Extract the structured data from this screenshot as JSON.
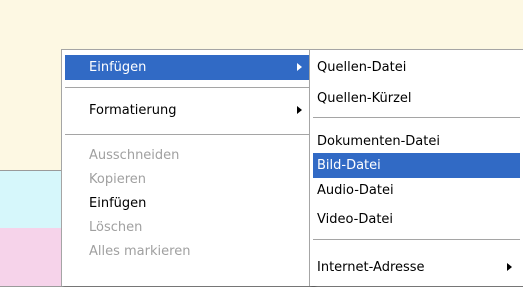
{
  "context_menu": {
    "items": [
      {
        "label": "Einfügen"
      },
      {
        "label": "Formatierung"
      },
      {
        "label": "Ausschneiden"
      },
      {
        "label": "Kopieren"
      },
      {
        "label": "Einfügen"
      },
      {
        "label": "Löschen"
      },
      {
        "label": "Alles markieren"
      }
    ]
  },
  "submenu": {
    "items": [
      {
        "label": "Quellen-Datei"
      },
      {
        "label": "Quellen-Kürzel"
      },
      {
        "label": "Dokumenten-Datei"
      },
      {
        "label": "Bild-Datei"
      },
      {
        "label": "Audio-Datei"
      },
      {
        "label": "Video-Datei"
      },
      {
        "label": "Internet-Adresse"
      }
    ]
  },
  "colors": {
    "highlight": "#316ac5",
    "disabled_text": "#a0a0a0",
    "background": "#fdf8e3",
    "band_cyan": "#d6f7fb",
    "band_pink": "#f6d3ea"
  }
}
